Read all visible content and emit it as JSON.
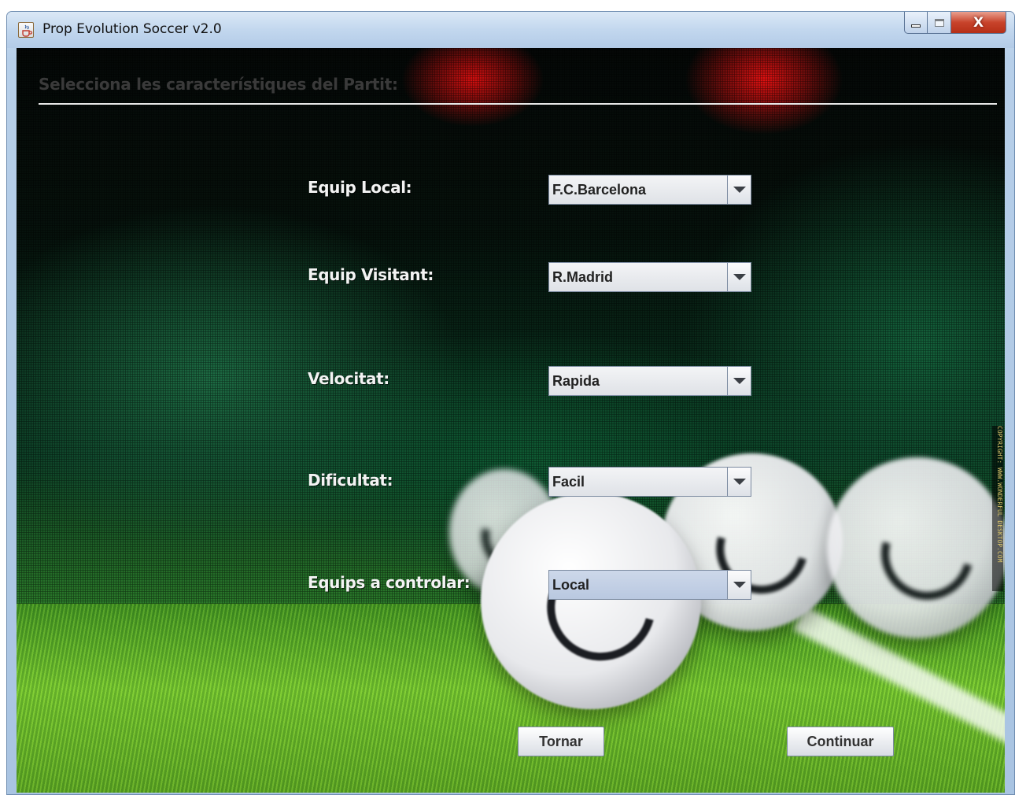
{
  "window": {
    "title": "Prop Evolution Soccer v2.0",
    "close_glyph": "X"
  },
  "page": {
    "header": "Selecciona les característiques del Partit:"
  },
  "form": {
    "local_team": {
      "label": "Equip Local:",
      "value": "F.C.Barcelona"
    },
    "visiting_team": {
      "label": "Equip Visitant:",
      "value": "R.Madrid"
    },
    "speed": {
      "label": "Velocitat:",
      "value": "Rapida"
    },
    "difficulty": {
      "label": "Dificultat:",
      "value": "Facil"
    },
    "controlled_teams": {
      "label": "Equips a controlar:",
      "value": "Local"
    }
  },
  "buttons": {
    "back": "Tornar",
    "continue": "Continuar"
  },
  "background": {
    "watermark": "COPYRIGHT: WWW.WONDERFUL DESKTOP.COM"
  },
  "icons": {
    "app": "java-cup-icon",
    "minimize": "minimize-icon",
    "maximize": "maximize-icon",
    "close": "close-icon",
    "dropdown": "chevron-down-icon"
  }
}
